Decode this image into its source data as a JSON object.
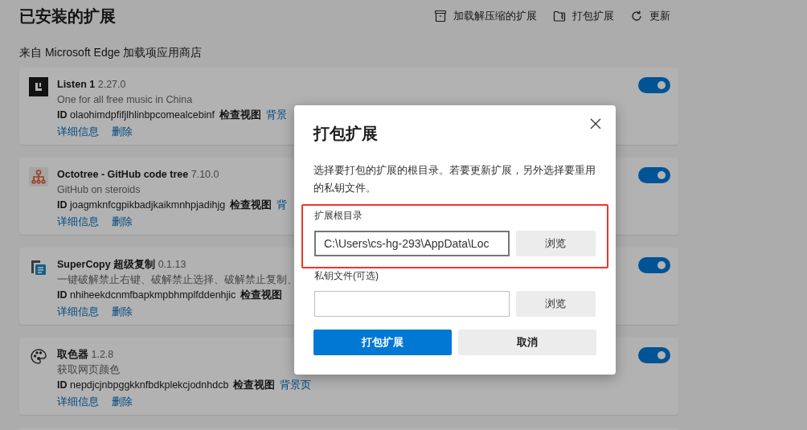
{
  "header": {
    "title": "已安装的扩展",
    "actions": [
      {
        "kind": "unpacked",
        "label": "加载解压缩的扩展"
      },
      {
        "kind": "pack",
        "label": "打包扩展"
      },
      {
        "kind": "refresh",
        "label": "更新"
      }
    ]
  },
  "section_label": "来自 Microsoft Edge 加载项应用商店",
  "extensions": [
    {
      "kind": "listen",
      "name": "Listen 1",
      "version": "2.27.0",
      "description": "One for all free music in China",
      "id_label": "ID",
      "id": "olaohimdpfifjlhlinbpcomealcebinf",
      "inspect_label": "检查视图",
      "inspect_link": "背景",
      "links": [
        "详细信息",
        "删除"
      ],
      "on": true
    },
    {
      "kind": "tree",
      "name": "Octotree - GitHub code tree",
      "version": "7.10.0",
      "description": "GitHub on steroids",
      "id_label": "ID",
      "id": "joagmknfcgpikbadjkaikmnhpjadihjg",
      "inspect_label": "检查视图",
      "inspect_link": "背",
      "links": [
        "详细信息",
        "删除"
      ],
      "on": true
    },
    {
      "kind": "copy",
      "name": "SuperCopy 超级复制",
      "version": "0.1.13",
      "description": "一键破解禁止右键、破解禁止选择、破解禁止复制、",
      "id_label": "ID",
      "id": "nhiheekdcnmfbapkmpbhmplfddenhjic",
      "inspect_label": "检查视图",
      "links": [
        "详细信息",
        "删除"
      ],
      "on": true
    },
    {
      "kind": "palette",
      "name": "取色器",
      "version": "1.2.8",
      "description": "获取网页颜色",
      "id_label": "ID",
      "id": "nepdjcjnbpggkknfbdkplekcjodnhdcb",
      "inspect_label": "检查视图",
      "inspect_link": "背景页",
      "links": [
        "详细信息",
        "删除"
      ],
      "on": true
    }
  ],
  "dialog": {
    "title": "打包扩展",
    "description": "选择要打包的扩展的根目录。若要更新扩展，另外选择要重用的私钥文件。",
    "fields": [
      {
        "label": "扩展根目录",
        "value": "C:\\Users\\cs-hg-293\\AppData\\Loc",
        "button": "浏览",
        "highlighted": true
      },
      {
        "label": "私钥文件(可选)",
        "button": "浏览",
        "highlighted": false
      }
    ],
    "primary_button": "打包扩展",
    "cancel_button": "取消"
  }
}
